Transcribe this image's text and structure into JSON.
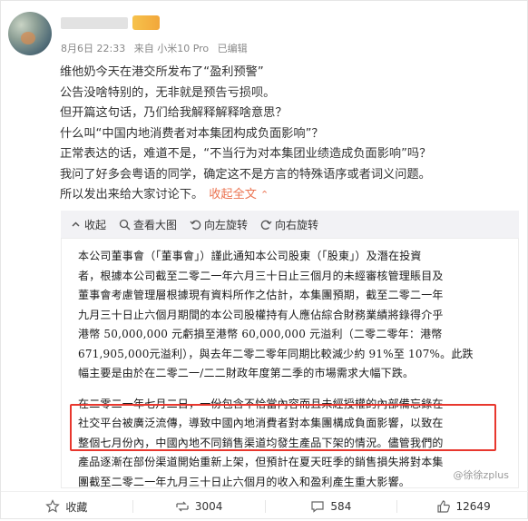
{
  "post": {
    "meta": {
      "date": "8月6日 22:33",
      "source": "来自 小米10 Pro",
      "edited": "已编辑"
    },
    "lines": [
      "维他奶今天在港交所发布了“盈利预警”",
      "公告没啥特别的，无非就是预告亏损呗。",
      "但开篇这句话，乃们给我解释解释啥意思？",
      "什么叫“中国内地消费者对本集团构成负面影响”？",
      "正常表达的话，难道不是，“不当行为对本集团业绩造成负面影响”吗？",
      "我问了好多会粤语的同学，确定这不是方言的特殊语序或者词义问题。",
      "所以发出来给大家讨论下。"
    ],
    "expand_label": "收起全文",
    "expand_icon": "chevron-up-icon"
  },
  "media": {
    "tools": [
      {
        "label": "收起",
        "icon": "collapse-icon"
      },
      {
        "label": "查看大图",
        "icon": "zoom-icon"
      },
      {
        "label": "向左旋转",
        "icon": "rotate-left-icon"
      },
      {
        "label": "向右旋转",
        "icon": "rotate-right-icon"
      }
    ],
    "doc_lines": [
      "本公司董事會（「董事會」）謹此通知本公司股東（「股東」）及潛在投資",
      "者，根據本公司截至二零二一年六月三十日止三個月的未經審核管理賬目及",
      "董事會考慮管理層根據現有資料所作之估計，本集團預期，截至二零二一年",
      "九月三十日止六個月期間的本公司股權持有人應佔綜合財務業績將錄得介乎",
      "港幣 50,000,000 元虧損至港幣 60,000,000 元溢利（二零二零年：港幣",
      "671,905,000元溢利），與去年二零二零年同期比較減少約 91%至 107%。此跌",
      "幅主要是由於在二零二一/二二財政年度第二季的市場需求大幅下跌。"
    ],
    "doc_lines_2": [
      "在二零二一年七月二日，一份包含不恰當內容而且未經授權的內部備忘錄在",
      "社交平台被廣泛流傳，導致中國內地消費者對本集團構成負面影響，以致在",
      "整個七月份內，中國內地不同銷售渠道均發生產品下架的情況。儘管我們的",
      "產品逐漸在部份渠道開始重新上架，但預計在夏天旺季的銷售損失將對本集",
      "團截至二零二一年九月三十日止六個月的收入和盈利產生重大影響。"
    ],
    "watermark": "@徐徐zplus"
  },
  "actions": [
    {
      "label": "收藏",
      "icon": "star-icon"
    },
    {
      "label": "3004",
      "icon": "repost-icon"
    },
    {
      "label": "584",
      "icon": "comment-icon"
    },
    {
      "label": "12649",
      "icon": "like-icon"
    }
  ],
  "colors": {
    "accent": "#eb7350",
    "highlight": "#e8372e"
  }
}
